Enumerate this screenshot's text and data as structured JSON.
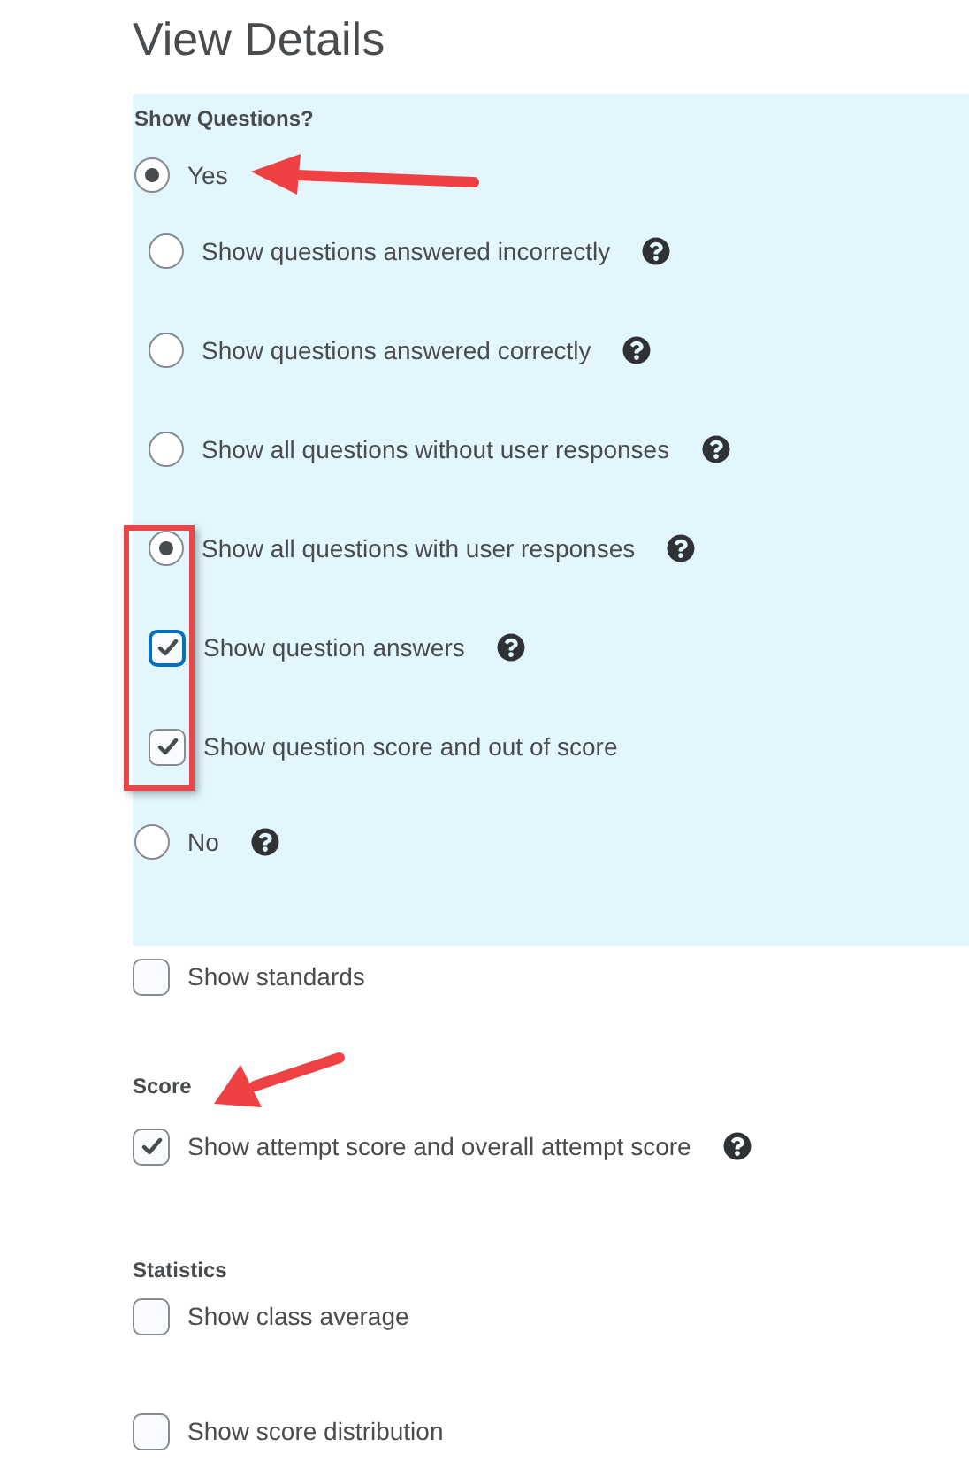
{
  "title": "View Details",
  "show_questions": {
    "label": "Show Questions?",
    "options": [
      {
        "kind": "radio",
        "label": "Yes",
        "selected": true,
        "help": false,
        "children": [
          {
            "kind": "radio",
            "label": "Show questions answered incorrectly",
            "selected": false,
            "help": true
          },
          {
            "kind": "radio",
            "label": "Show questions answered correctly",
            "selected": false,
            "help": true
          },
          {
            "kind": "radio",
            "label": "Show all questions without user responses",
            "selected": false,
            "help": true
          },
          {
            "kind": "radio",
            "label": "Show all questions with user responses",
            "selected": true,
            "help": true
          },
          {
            "kind": "checkbox",
            "label": "Show question answers",
            "checked": true,
            "focused": true,
            "help": true
          },
          {
            "kind": "checkbox",
            "label": "Show question score and out of score",
            "checked": true,
            "focused": false,
            "help": false
          }
        ]
      },
      {
        "kind": "radio",
        "label": "No",
        "selected": false,
        "help": true
      }
    ]
  },
  "other_options": [
    {
      "kind": "checkbox",
      "label": "Show standards",
      "checked": false,
      "focused": false,
      "help": false
    }
  ],
  "score": {
    "label": "Score",
    "options": [
      {
        "kind": "checkbox",
        "label": "Show attempt score and overall attempt score",
        "checked": true,
        "focused": false,
        "help": true
      }
    ]
  },
  "statistics": {
    "label": "Statistics",
    "options": [
      {
        "kind": "checkbox",
        "label": "Show class average",
        "checked": false,
        "focused": false,
        "help": false
      },
      {
        "kind": "checkbox",
        "label": "Show score distribution",
        "checked": false,
        "focused": false,
        "help": false
      }
    ]
  }
}
